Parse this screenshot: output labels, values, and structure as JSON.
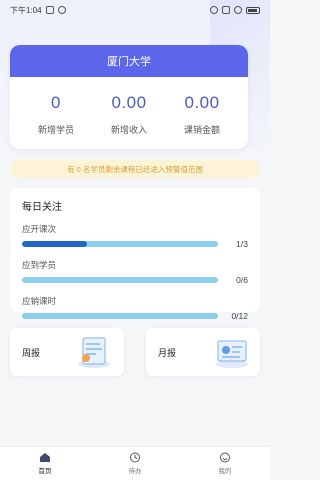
{
  "status_bar": {
    "time": "下午1:04"
  },
  "school": {
    "name": "厦门大学"
  },
  "stats": [
    {
      "value": "0",
      "label": "新增学员"
    },
    {
      "value": "0.00",
      "label": "新增收入"
    },
    {
      "value": "0.00",
      "label": "课销金额"
    }
  ],
  "notice": {
    "text": "有 0 名学员剩余课程已经进入预警值范围"
  },
  "focus": {
    "title": "每日关注",
    "rows": [
      {
        "label": "应开课次",
        "count": "1/3",
        "progress": 0.3333
      },
      {
        "label": "应到学员",
        "count": "0/6",
        "progress": 0
      },
      {
        "label": "应销课时",
        "count": "0/12",
        "progress": 0
      }
    ]
  },
  "reports": {
    "weekly": "周报",
    "monthly": "月报"
  },
  "tabs": [
    {
      "label": "首页",
      "icon": "home-icon"
    },
    {
      "label": "待办",
      "icon": "clock-icon"
    },
    {
      "label": "我的",
      "icon": "face-icon"
    }
  ],
  "colors": {
    "accent": "#5b66ea",
    "progress_fill": "#1f66c8",
    "progress_track": "#8dd0ee",
    "notice_bg": "#fdf3d7",
    "notice_text": "#d4a33a"
  }
}
